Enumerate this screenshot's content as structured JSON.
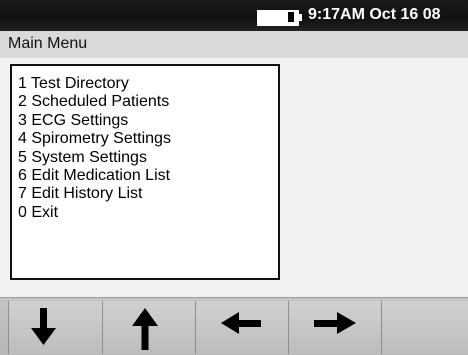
{
  "status_bar": {
    "clock": "9:17AM Oct 16 08",
    "battery_icon": "battery-icon"
  },
  "header": {
    "title": "Main Menu"
  },
  "menu": {
    "items": [
      {
        "label": "1 Test Directory"
      },
      {
        "label": "2 Scheduled Patients"
      },
      {
        "label": "3 ECG Settings"
      },
      {
        "label": "4 Spirometry Settings"
      },
      {
        "label": "5 System Settings"
      },
      {
        "label": "6 Edit Medication List"
      },
      {
        "label": "7 Edit History List"
      },
      {
        "label": "0 Exit"
      }
    ]
  },
  "softkeys": [
    {
      "icon": "arrow-down-icon"
    },
    {
      "icon": "arrow-up-icon"
    },
    {
      "icon": "arrow-left-icon"
    },
    {
      "icon": "arrow-right-icon"
    },
    {
      "icon": ""
    }
  ]
}
